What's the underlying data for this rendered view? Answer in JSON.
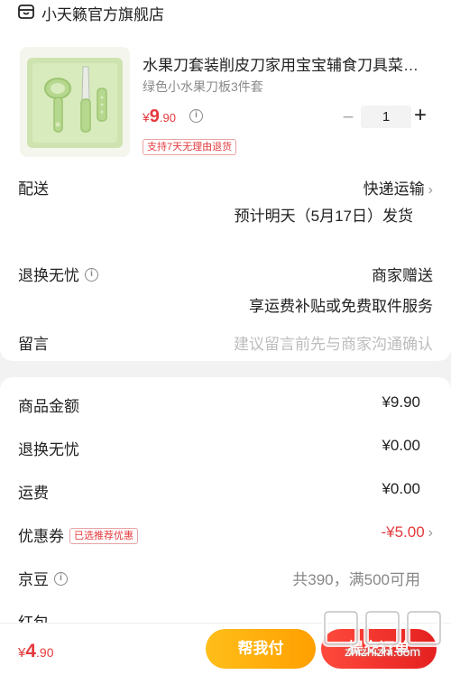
{
  "store": {
    "name": "小天籁官方旗舰店",
    "icon": "store-icon"
  },
  "product": {
    "title": "水果刀套装削皮刀家用宝宝辅食刀具菜…",
    "spec": "绿色小水果刀板3件套",
    "price_yen": "¥",
    "price_int": "9",
    "price_dec": ".90",
    "quantity": "1",
    "minus": "−",
    "plus": "+",
    "return_badge": "支持7天无理由退货",
    "thumb_color": "#cfe3b0"
  },
  "shipping": {
    "label": "配送",
    "method": "快递运输",
    "eta": "预计明天（5月17日）发货"
  },
  "returns": {
    "label": "退换无忧",
    "value": "商家赠送",
    "detail": "享运费补贴或免费取件服务"
  },
  "message": {
    "label": "留言",
    "placeholder": "建议留言前先与商家沟通确认"
  },
  "summary": {
    "goods_label": "商品金额",
    "goods_value": "¥9.90",
    "returns_label": "退换无忧",
    "returns_value": "¥0.00",
    "freight_label": "运费",
    "freight_value": "¥0.00",
    "coupon_label": "优惠券",
    "coupon_badge": "已选推荐优惠",
    "coupon_value": "-¥5.00",
    "jingdou_label": "京豆",
    "jingdou_value": "共390，满500可用",
    "hongbao_label": "红包"
  },
  "bottom": {
    "total_yen": "¥",
    "total_int": "4",
    "total_dec": ".90",
    "help_pay": "帮我付",
    "submit": "提交订单",
    "watermark": "zhizhizhi.com"
  },
  "colors": {
    "accent": "#e4393c",
    "help_pay": "#ffb300",
    "submit": "#e4201f"
  }
}
